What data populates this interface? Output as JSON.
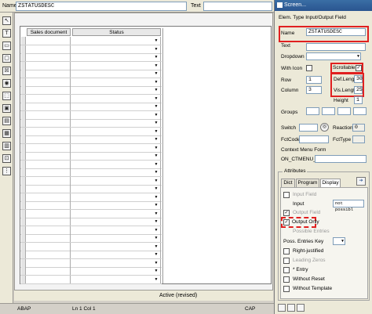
{
  "topbar": {
    "name_label": "Name",
    "name_value": "ZSTATUSDESC",
    "text_label": "Text",
    "text_value": ""
  },
  "palette": {
    "tools": [
      {
        "icon": "pointer-icon",
        "glyph": "↖"
      },
      {
        "icon": "text-field-icon",
        "glyph": "T"
      },
      {
        "icon": "input-field-icon",
        "glyph": "▭"
      },
      {
        "icon": "pushbutton-icon",
        "glyph": "▢"
      },
      {
        "icon": "checkbox-icon",
        "glyph": "☒"
      },
      {
        "icon": "radio-button-icon",
        "glyph": "◉"
      },
      {
        "icon": "box-icon",
        "glyph": "⬚"
      },
      {
        "icon": "subscreen-icon",
        "glyph": "▣"
      },
      {
        "icon": "tabstrip-icon",
        "glyph": "▤"
      },
      {
        "icon": "table-control-icon",
        "glyph": "▦"
      },
      {
        "icon": "custom-control-icon",
        "glyph": "▥"
      },
      {
        "icon": "status-icon-icon",
        "glyph": "⊡"
      },
      {
        "icon": "step-loop-icon",
        "glyph": "⋮"
      }
    ]
  },
  "table": {
    "col_sales_document": "Sales document",
    "col_status": "Status",
    "row_count": 30
  },
  "statusbar": {
    "mode": "Active (revised)"
  },
  "bottombar": {
    "program": "ABAP",
    "position": "Ln  1 Col  1",
    "caps": "CAP"
  },
  "panel": {
    "title": "Screen...",
    "elem_type": "Elem. Type  Input/Output Field",
    "name_label": "Name",
    "name_value": "ZSTATUSDESC",
    "text_label": "Text",
    "dropdown_label": "Dropdown",
    "with_icon_label": "With Icon",
    "scrollable_label": "Scrollable",
    "row_label": "Row",
    "row_value": "1",
    "column_label": "Column",
    "column_value": "3",
    "def_length_label": "Def.Length",
    "def_length_value": "30",
    "vis_length_label": "Vis.Length",
    "vis_length_value": "25",
    "height_label": "Height",
    "height_value": "1",
    "groups_label": "Groups",
    "switch_label": "Switch",
    "reaction_label": "Reaction",
    "reaction_value": "0",
    "fctcode_label": "FctCode",
    "fcttype_label": "FctType",
    "context_menu_label": "Context Menu Form",
    "context_menu_prefix": "ON_CTMENU_",
    "attributes_label": "Attributes",
    "tabs": [
      "Dict",
      "Program",
      "Display"
    ],
    "input_field_label": "Input Field",
    "input_label": "Input",
    "input_value": "not possibl",
    "output_field_label": "Output Field",
    "output_only_label": "Output Only",
    "possible_entries_label": "Possible Entries",
    "poss_entries_key_label": "Poss. Entries Key",
    "right_justified_label": "Right-justified",
    "leading_zeros_label": "Leading Zeros",
    "entry_label": "* Entry",
    "without_reset_label": "Without Reset",
    "without_template_label": "Without Template"
  }
}
